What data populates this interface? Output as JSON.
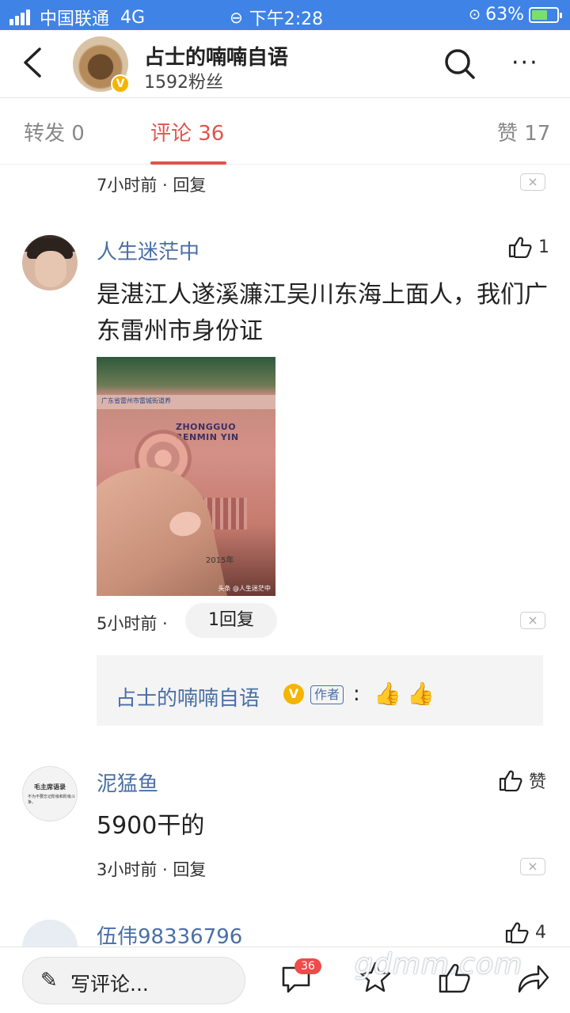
{
  "status_bar": {
    "carrier": "中国联通",
    "network": "4G",
    "time": "下午2:28",
    "battery_percent": "63%",
    "battery_level": 0.63
  },
  "header": {
    "back_icon": "chevron-left-icon",
    "title": "占士的喃喃自语",
    "followers": "1592粉丝",
    "search_icon": "search-icon",
    "more_icon": "more-icon",
    "more_glyph": "···"
  },
  "tabs": [
    {
      "label": "转发 0"
    },
    {
      "label": "评论 36",
      "active": true
    },
    {
      "label": "赞 17"
    }
  ],
  "comments": {
    "top_meta": "7小时前 · 回复",
    "close_glyph": "×",
    "c1": {
      "username": "人生迷茫中",
      "likes": "1",
      "text": "是湛江人遂溪濂江吴川东海上面人，我们广东雷州市身份证",
      "time": "5小时前 ·",
      "reply_count": "1回复",
      "photo": {
        "band_text": "广东省雷州市雷城街道养",
        "note_text": "ZHONGGUO RENMIN YIN",
        "year": "2015年",
        "watermark": "头条 @人生迷茫中"
      },
      "reply": {
        "name": "占士的喃喃自语",
        "verified": "V",
        "author_tag": "作者",
        "colon": ":",
        "emoji1": "👍",
        "emoji2": "👍"
      }
    },
    "c2": {
      "username": "泥猛鱼",
      "likes": "赞",
      "text": "5900干的",
      "meta": "3小时前 · 回复",
      "avatar_text1": "毛主席语录",
      "avatar_text2": "不为不要忘记阶级和阶级斗争。"
    },
    "c3": {
      "username": "伍伟98336796",
      "likes": "4"
    }
  },
  "bottom_bar": {
    "write_label": "写评论...",
    "comment_count": "36",
    "watermark": "gdmm.com"
  },
  "colors": {
    "status_bar": "#3f83e6",
    "accent_red": "#e0554b",
    "username_blue": "#4a6fa5",
    "verified_gold": "#f5b400"
  }
}
